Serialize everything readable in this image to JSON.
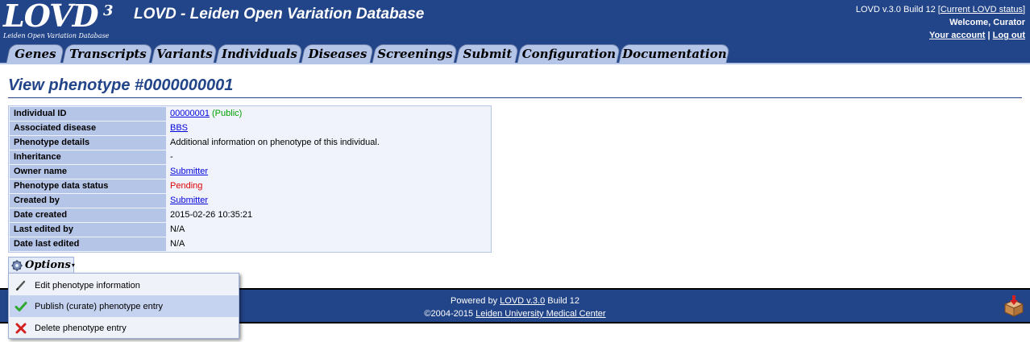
{
  "header": {
    "logo": {
      "text": "LOVD",
      "sup": "3",
      "subtitle": "Leiden Open Variation Database"
    },
    "site_title": "LOVD - Leiden Open Variation Database",
    "version_text": "LOVD v.3.0 Build 12 [",
    "version_link": "Current LOVD status",
    "version_close": "]",
    "welcome": "Welcome, Curator",
    "your_account": "Your account",
    "separator": "|",
    "log_out": "Log out"
  },
  "tabs": [
    "Genes",
    "Transcripts",
    "Variants",
    "Individuals",
    "Diseases",
    "Screenings",
    "Submit",
    "Configuration",
    "Documentation"
  ],
  "page_title": "View phenotype #0000000001",
  "details": {
    "individual_id": {
      "label": "Individual ID",
      "value": "00000001",
      "extra": "(Public)"
    },
    "associated_disease": {
      "label": "Associated disease",
      "value": "BBS"
    },
    "phenotype_details": {
      "label": "Phenotype details",
      "value": "Additional information on phenotype of this individual."
    },
    "inheritance": {
      "label": "Inheritance",
      "value": "-"
    },
    "owner_name": {
      "label": "Owner name",
      "value": "Submitter"
    },
    "data_status": {
      "label": "Phenotype data status",
      "value": "Pending"
    },
    "created_by": {
      "label": "Created by",
      "value": "Submitter"
    },
    "date_created": {
      "label": "Date created",
      "value": "2015-02-26 10:35:21"
    },
    "last_edited_by": {
      "label": "Last edited by",
      "value": "N/A"
    },
    "date_last_edited": {
      "label": "Date last edited",
      "value": "N/A"
    }
  },
  "options": {
    "label": "Options",
    "caret": "▾",
    "items": [
      {
        "label": "Edit phenotype information",
        "icon": "pencil-icon"
      },
      {
        "label": "Publish (curate) phenotype entry",
        "icon": "checkmark-icon"
      },
      {
        "label": "Delete phenotype entry",
        "icon": "cross-icon"
      }
    ]
  },
  "footer": {
    "powered_by": "Powered by",
    "lovd_link": "LOVD v.3.0",
    "build": "Build 12",
    "copyright": "©2004-2015",
    "lumc_link": "Leiden University Medical Center"
  },
  "colors": {
    "header_bg": "#224488",
    "tab_bg": "#b5c5e8",
    "table_label_bg": "#b5c5e8",
    "table_value_bg": "#f0f3fb",
    "link": "#0000dd",
    "public": "#00a000",
    "pending": "#dd0000",
    "menu_hover": "#c5d3f0"
  }
}
